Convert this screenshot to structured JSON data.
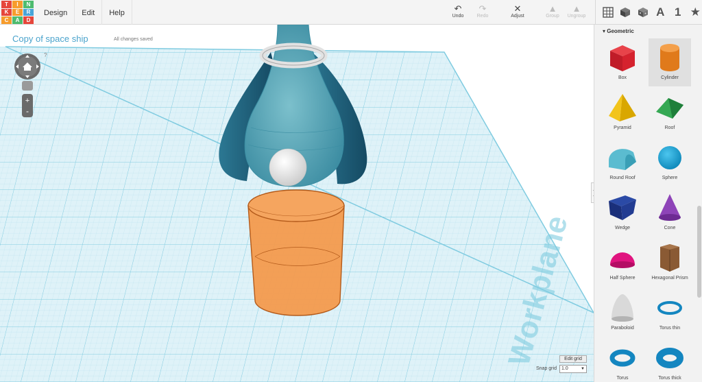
{
  "logo": {
    "letters": [
      "T",
      "I",
      "N",
      "K",
      "E",
      "R",
      "C",
      "A",
      "D"
    ],
    "colors": [
      "#e6463b",
      "#f79c2c",
      "#4ebc6f",
      "#e6463b",
      "#f79c2c",
      "#48a5d8",
      "#f79c2c",
      "#4ebc6f",
      "#e6463b"
    ]
  },
  "menu": {
    "design": "Design",
    "edit": "Edit",
    "help": "Help"
  },
  "toolbar": {
    "undo": "Undo",
    "redo": "Redo",
    "adjust": "Adjust",
    "group": "Group",
    "ungroup": "Ungroup"
  },
  "view_icons": {
    "text_tool": "A",
    "number_tool": "1"
  },
  "canvas": {
    "design_title": "Copy of space ship",
    "save_status": "All changes saved",
    "help_mark": "?",
    "workplane_label": "Workplane",
    "edit_grid": "Edit grid",
    "snap_grid_label": "Snap grid",
    "snap_grid_value": "1.0"
  },
  "panel": {
    "category": "Geometric",
    "shapes": [
      "Box",
      "Cylinder",
      "Pyramid",
      "Roof",
      "Round Roof",
      "Sphere",
      "Wedge",
      "Cone",
      "Half Sphere",
      "Hexagonal Prism",
      "Paraboloid",
      "Torus thin",
      "Torus",
      "Torus thick"
    ]
  },
  "colors": {
    "accent": "#4aa3cc",
    "cylinder": "#f39a4d",
    "ship_dark": "#1e5d78",
    "ship_light": "#5aa7b8",
    "grid": "#7fcbe0"
  }
}
